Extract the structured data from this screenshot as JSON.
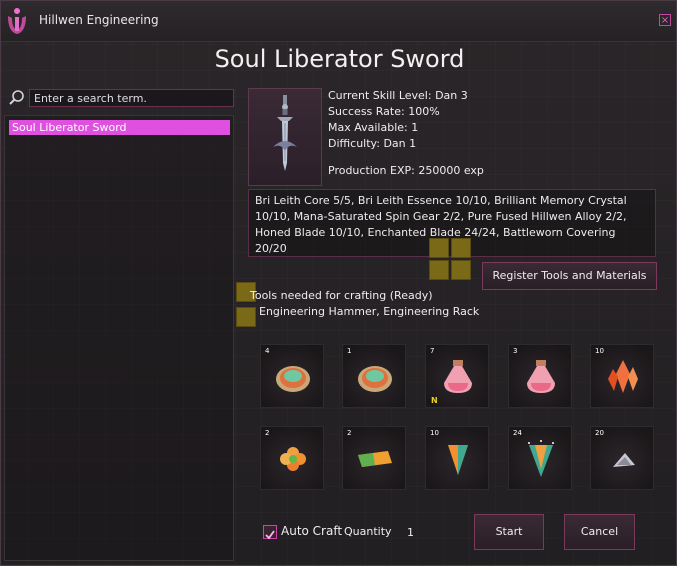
{
  "window": {
    "title": "Hillwen Engineering"
  },
  "item": {
    "name": "Soul Liberator Sword",
    "skill_level": "Current Skill Level: Dan 3",
    "success_rate": "Success Rate: 100%",
    "max_available": "Max Available: 1",
    "difficulty": "Difficulty: Dan 1",
    "production_exp": "Production EXP: 250000 exp"
  },
  "search": {
    "placeholder": "Enter a search term."
  },
  "list": {
    "items": [
      {
        "label": "Soul Liberator Sword",
        "selected": true
      }
    ]
  },
  "materials_text": "Bri Leith Core 5/5, Bri Leith Essence 10/10, Brilliant Memory Crystal 10/10, Mana-Saturated Spin Gear 2/2, Pure Fused Hillwen Alloy 2/2, Honed Blade 10/10, Enchanted Blade 24/24, Battleworn Covering 20/20",
  "register_button": "Register Tools and Materials",
  "tools": {
    "label": "Tools needed for crafting (Ready)",
    "list": "Engineering Hammer, Engineering Rack"
  },
  "slots": [
    {
      "qty": "4",
      "icon": "bri-leith-core-icon"
    },
    {
      "qty": "1",
      "icon": "bri-leith-core-icon"
    },
    {
      "qty": "7",
      "icon": "potion-icon",
      "tag": "N"
    },
    {
      "qty": "3",
      "icon": "potion-icon"
    },
    {
      "qty": "10",
      "icon": "crystal-icon"
    },
    {
      "qty": "2",
      "icon": "spin-gear-icon"
    },
    {
      "qty": "2",
      "icon": "alloy-icon"
    },
    {
      "qty": "10",
      "icon": "honed-blade-icon"
    },
    {
      "qty": "24",
      "icon": "enchanted-blade-icon"
    },
    {
      "qty": "20",
      "icon": "covering-icon"
    }
  ],
  "auto_craft": {
    "label": "Auto Craft",
    "checked": true
  },
  "quantity": {
    "label": "Quantity",
    "value": "1"
  },
  "buttons": {
    "start": "Start",
    "cancel": "Cancel"
  },
  "colors": {
    "accent": "#e050e0",
    "border": "#7a3a5e",
    "background": "#221f22"
  }
}
